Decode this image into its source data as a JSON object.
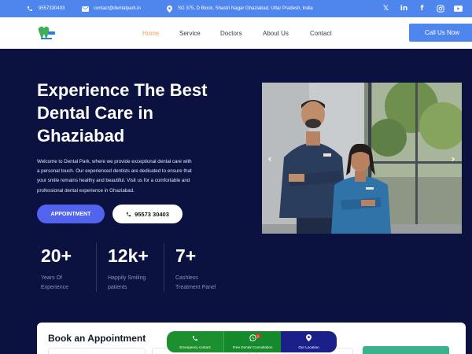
{
  "topbar": {
    "phone": "9557330403",
    "email": "contact@dentalpark.in",
    "address": "SG 375, D Block, Shastri Nagar Ghaziabad, Uttar Pradesh, India",
    "social": [
      "x-icon",
      "linkedin-icon",
      "facebook-icon",
      "instagram-icon",
      "youtube-icon"
    ]
  },
  "nav": {
    "items": [
      "Home",
      "Service",
      "Doctors",
      "About Us",
      "Contact"
    ],
    "active": "Home",
    "cta_label": "Call Us Now"
  },
  "hero": {
    "title_line1": "Experience The Best",
    "title_line2": "Dental Care in",
    "title_line3": "Ghaziabad",
    "desc_line1": "Welcome to Dental Park, where we provide exceptional dental care with",
    "desc_line2": "a personal touch. Our experienced dentists are dedicated to ensure that",
    "desc_line3": "your smile remains healthy and beautiful. Visit us for a comfortable and",
    "desc_line4": "professional dental experience in Ghaziabad.",
    "appointment_label": "APPOINTMENT",
    "phone_label": "95573 30403"
  },
  "stats": [
    {
      "value": "20+",
      "line1": "Years Of",
      "line2": "Experience"
    },
    {
      "value": "12k+",
      "line1": "Happily Smiling",
      "line2": "patients"
    },
    {
      "value": "7+",
      "line1": "Cashless",
      "line2": "Treatment Panel"
    }
  ],
  "booking": {
    "title": "Book an Appointment"
  },
  "float_bar": {
    "emergency": "Emergency contact",
    "consult": "Free Dental Consultation",
    "location": "Our Location",
    "badge": "1"
  },
  "colors": {
    "topbar": "#4f86ee",
    "hero_bg": "#0b1240",
    "accent": "#5263ee",
    "nav_active": "#e8a04a"
  }
}
